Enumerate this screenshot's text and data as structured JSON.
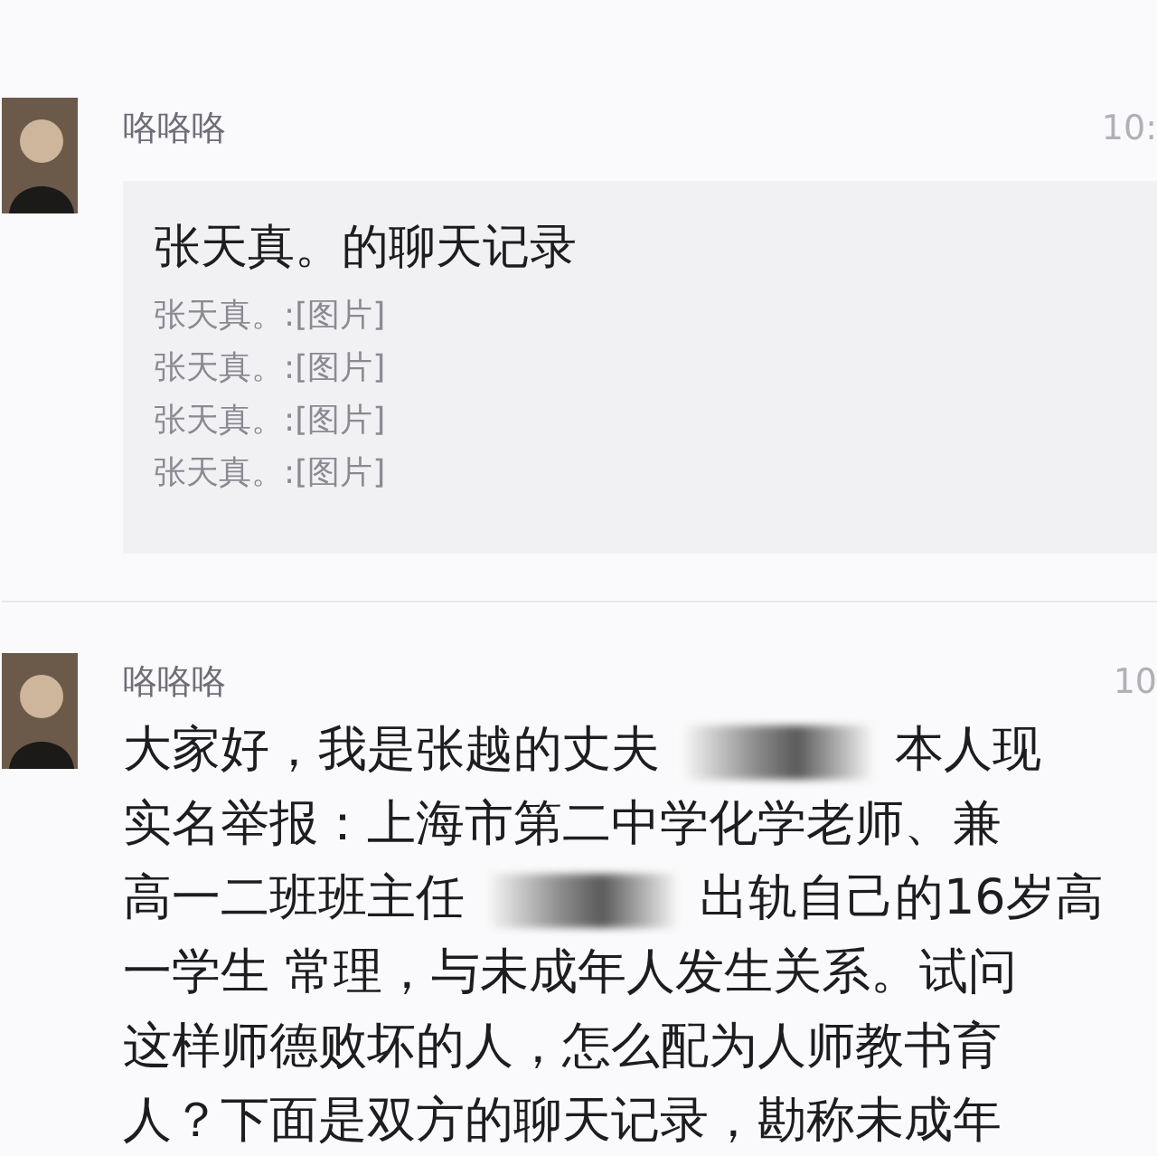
{
  "messages": [
    {
      "kind": "forward",
      "sender": "咯咯咯",
      "time": "10:",
      "card": {
        "title": "张天真。的聊天记录",
        "rows": [
          "张天真。:[图片]",
          "张天真。:[图片]",
          "张天真。:[图片]",
          "张天真。:[图片]"
        ]
      }
    },
    {
      "kind": "text",
      "sender": "咯咯咯",
      "time": "10",
      "lines": [
        [
          {
            "kind": "text",
            "text": "大家好，我是张越的丈夫"
          },
          {
            "kind": "redaction"
          },
          {
            "kind": "text",
            "text": "本人现"
          }
        ],
        [
          {
            "kind": "text",
            "text": "实名举报：上海市第二中学化学老师、兼"
          }
        ],
        [
          {
            "kind": "text",
            "text": "高一二班班主任"
          },
          {
            "kind": "redaction"
          },
          {
            "kind": "text",
            "text": "出轨自己的16岁高"
          }
        ],
        [
          {
            "kind": "text",
            "text": "一学生 常理，与未成年人发生关系。试问"
          }
        ],
        [
          {
            "kind": "text",
            "text": "这样师德败坏的人，怎么配为人师教书育"
          }
        ],
        [
          {
            "kind": "text",
            "text": "人？下面是双方的聊天记录，勘称未成年"
          }
        ]
      ]
    }
  ]
}
